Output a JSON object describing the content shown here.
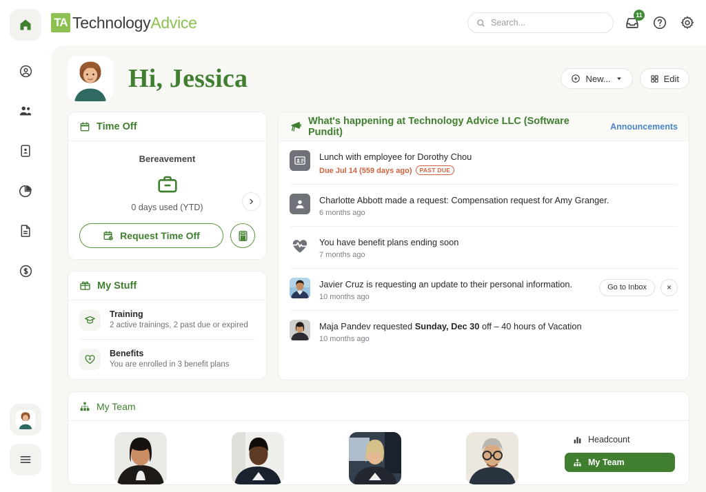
{
  "brand": {
    "mark": "TA",
    "name_part1": "Technology",
    "name_part2": "Advice"
  },
  "topbar": {
    "search": {
      "placeholder": "Search...",
      "value": ""
    },
    "inbox": {
      "icon": "inbox-icon",
      "badge": "11"
    },
    "help": {
      "icon": "help-circle-icon"
    },
    "settings": {
      "icon": "gear-icon"
    }
  },
  "rail": {
    "home": {
      "icon": "home-icon",
      "label": "Home"
    },
    "items": [
      {
        "icon": "person-circle-icon",
        "label": "My Info"
      },
      {
        "icon": "people-icon",
        "label": "People"
      },
      {
        "icon": "id-card-icon",
        "label": "Hiring"
      },
      {
        "icon": "pie-chart-icon",
        "label": "Reports"
      },
      {
        "icon": "document-icon",
        "label": "Files"
      },
      {
        "icon": "dollar-circle-icon",
        "label": "Payroll"
      }
    ],
    "avatar": {
      "icon": "user-avatar",
      "label": "Jessica"
    },
    "menu": {
      "icon": "hamburger-icon",
      "label": "Menu"
    }
  },
  "greeting": {
    "avatar": "user-avatar",
    "title": "Hi, Jessica",
    "new_button": {
      "label": "New...",
      "icon": "plus-circle-icon",
      "caret": "chevron-down-icon"
    },
    "edit_button": {
      "label": "Edit",
      "icon": "grid-icon"
    }
  },
  "time_off": {
    "title": "Time Off",
    "icon": "calendar-icon",
    "policy": "Bereavement",
    "policy_icon": "briefcase-icon",
    "used": "0 days used (YTD)",
    "next_icon": "chevron-right-icon",
    "request_button": {
      "label": "Request Time Off",
      "icon": "calendar-add-icon"
    },
    "calculator_button": {
      "icon": "calculator-icon"
    }
  },
  "my_stuff": {
    "title": "My Stuff",
    "icon": "box-icon",
    "rows": [
      {
        "icon": "graduation-cap-icon",
        "title": "Training",
        "subtitle": "2 active trainings, 2 past due or expired"
      },
      {
        "icon": "heart-plus-icon",
        "title": "Benefits",
        "subtitle": "You are enrolled in 3 benefit plans"
      }
    ]
  },
  "announcements": {
    "title": "What's happening at Technology Advice LLC (Software Pundit)",
    "icon": "megaphone-icon",
    "link": "Announcements",
    "items": [
      {
        "icon": "id-card-icon",
        "icon_type": "glyph",
        "text": "Lunch with employee for Dorothy Chou",
        "sub": "Due Jul 14 (559 days ago)",
        "sub_kind": "due",
        "badge": "PAST DUE"
      },
      {
        "icon": "person-icon",
        "icon_type": "glyph",
        "text": "Charlotte Abbott made a request: Compensation request for Amy Granger.",
        "sub": "6 months ago",
        "sub_kind": "time"
      },
      {
        "icon": "heart-pulse-icon",
        "icon_type": "plain",
        "text": "You have benefit plans ending soon",
        "sub": "7 months ago",
        "sub_kind": "time"
      },
      {
        "icon": "user-photo",
        "icon_type": "photo",
        "text": "Javier Cruz is requesting an update to their personal information.",
        "sub": "10 months ago",
        "sub_kind": "time",
        "action_button": "Go to Inbox",
        "dismiss": "×"
      },
      {
        "icon": "user-photo",
        "icon_type": "photo",
        "text_pre": "Maja Pandev requested ",
        "text_bold": "Sunday, Dec 30",
        "text_post": " off – 40 hours of Vacation",
        "sub": "10 months ago",
        "sub_kind": "time"
      }
    ]
  },
  "my_team": {
    "title": "My Team",
    "icon": "org-chart-icon",
    "members": [
      {
        "photo": "team-member-1"
      },
      {
        "photo": "team-member-2"
      },
      {
        "photo": "team-member-3"
      },
      {
        "photo": "team-member-4"
      }
    ],
    "side": [
      {
        "label": "Headcount",
        "icon": "bar-chart-icon",
        "selected": false
      },
      {
        "label": "My Team",
        "icon": "org-chart-icon",
        "selected": true
      }
    ]
  },
  "colors": {
    "brand_green": "#3f7f2f",
    "logo_green": "#8cc152",
    "link_blue": "#4a86c8",
    "past_due": "#d2603c",
    "page_bg": "#f7f7f4"
  }
}
